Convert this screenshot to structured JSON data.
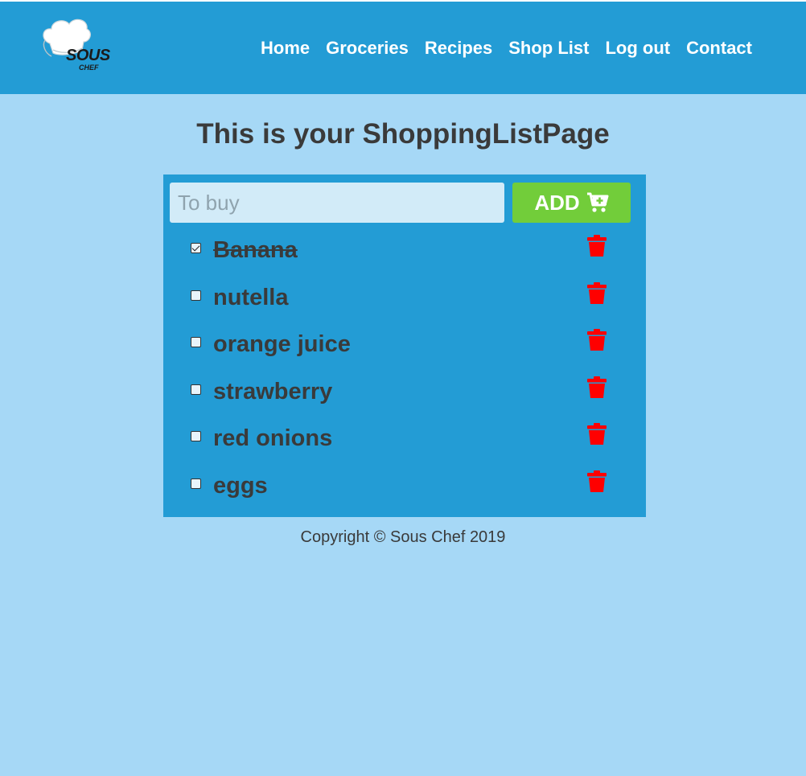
{
  "brand": {
    "name": "SOUS",
    "sub": "CHEF"
  },
  "nav": [
    "Home",
    "Groceries",
    "Recipes",
    "Shop List",
    "Log out",
    "Contact"
  ],
  "page_title": "This is your ShoppingListPage",
  "input": {
    "placeholder": "To buy",
    "value": ""
  },
  "add_button": {
    "label": "ADD",
    "icon": "cart-plus-icon"
  },
  "items": [
    {
      "label": "Banana",
      "checked": true
    },
    {
      "label": "nutella",
      "checked": false
    },
    {
      "label": "orange juice",
      "checked": false
    },
    {
      "label": "strawberry",
      "checked": false
    },
    {
      "label": "red onions",
      "checked": false
    },
    {
      "label": "eggs",
      "checked": false
    }
  ],
  "footer": "Copyright © Sous Chef 2019",
  "colors": {
    "header": "#239cd5",
    "background": "#a6d8f6",
    "add_button": "#72cd3a",
    "trash": "#ff0000",
    "text": "#3a3a3a"
  }
}
